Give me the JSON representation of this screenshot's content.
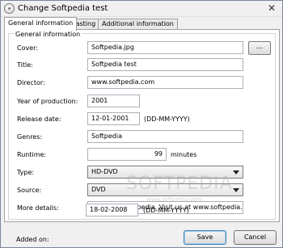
{
  "window": {
    "title": "Change Softpedia test"
  },
  "tabs": [
    "General information",
    "Casting",
    "Additional information"
  ],
  "group": {
    "legend": "General information"
  },
  "fields": {
    "cover": {
      "label": "Cover:",
      "value": "Softpedia.jpg",
      "browse_label": "..."
    },
    "title": {
      "label": "Title:",
      "value": "Softpedia test"
    },
    "director": {
      "label": "Director:",
      "value": "www.softpedia.com"
    },
    "year": {
      "label": "Year of production:",
      "value": "2001"
    },
    "release": {
      "label": "Release date:",
      "value": "12-01-2001",
      "format": "(DD-MM-YYYY)"
    },
    "genres": {
      "label": "Genres:",
      "value": "Softpedia"
    },
    "runtime": {
      "label": "Runtime:",
      "value": "99",
      "unit": "minutes"
    },
    "type": {
      "label": "Type:",
      "value": "HD-DVD"
    },
    "source": {
      "label": "Source:",
      "value": "DVD"
    },
    "details": {
      "label": "More details:",
      "value": "Tested by Softpedia. Visit us at www.softpedia.com"
    },
    "added": {
      "label": "Added on:",
      "value": "18-02-2008",
      "format": "(DD-MM-YYYY)"
    }
  },
  "watermark": {
    "text": "SOFTPEDIA",
    "sub": "www.softpedia.com"
  },
  "buttons": {
    "save": "Save",
    "cancel": "Cancel"
  },
  "icons": {
    "title": "app-icon",
    "close": "close-icon",
    "dropdown": "chevron-down-icon"
  }
}
